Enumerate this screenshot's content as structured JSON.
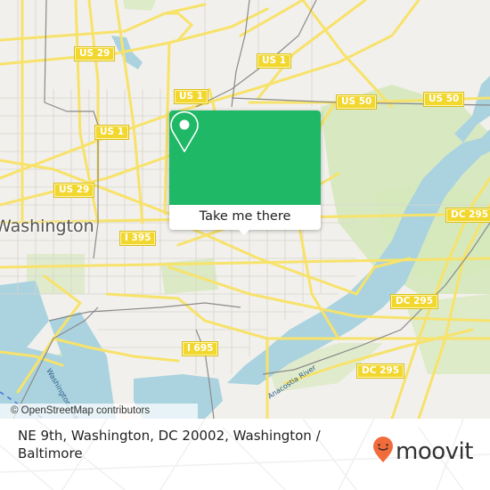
{
  "map": {
    "city_label": "Washington",
    "water_labels": {
      "washington_channel": "Washington Channel",
      "anacostia_river": "Anacostia River"
    },
    "route_shields": [
      {
        "id": "us29-north",
        "label": "US 29"
      },
      {
        "id": "us1-nw",
        "label": "US 1"
      },
      {
        "id": "us1-north",
        "label": "US 1"
      },
      {
        "id": "us1-center",
        "label": "US 1"
      },
      {
        "id": "us29-south",
        "label": "US 29"
      },
      {
        "id": "us50-west",
        "label": "US 50"
      },
      {
        "id": "us50-east",
        "label": "US 50"
      },
      {
        "id": "i395",
        "label": "I 395"
      },
      {
        "id": "i695",
        "label": "I 695"
      },
      {
        "id": "dc295-north",
        "label": "DC 295"
      },
      {
        "id": "dc295-mid",
        "label": "DC 295"
      },
      {
        "id": "dc295-south",
        "label": "DC 295"
      }
    ],
    "attribution": "© OpenStreetMap contributors",
    "colors": {
      "land": "#f2f0ec",
      "park": "#cfe6b0",
      "water": "#aad3df",
      "road": "#f7e26b",
      "rail": "#8a8a8a",
      "shield": "#f2d72e"
    }
  },
  "popup": {
    "icon": "location-pin-icon",
    "button_label": "Take me there",
    "accent_color": "#1fb866"
  },
  "footer": {
    "address": "NE 9th, Washington, DC 20002, Washington / Baltimore",
    "brand_name": "moovit",
    "brand_icon": "moovit-smiley-pin-icon",
    "brand_color": "#f26b3a"
  }
}
